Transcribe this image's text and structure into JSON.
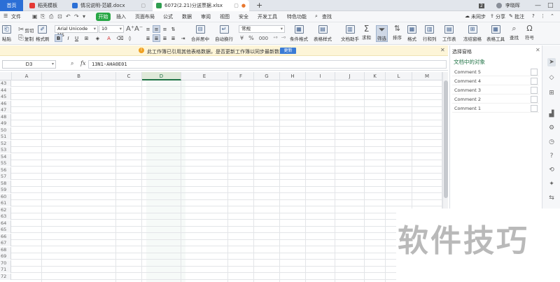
{
  "tabs": {
    "home": "首页",
    "t1": "稻壳模板",
    "t2": "情况说明-范颖.docx",
    "t3": "6072(2.21)分送票据.xlsx",
    "new_tab": "+",
    "badge": "2",
    "user": "李晓晖",
    "help": "?",
    "min": "—",
    "restore": "□",
    "close": "×"
  },
  "menu": {
    "file": "文件",
    "start": "开始",
    "insert": "插入",
    "page_layout": "页面布局",
    "formula": "公式",
    "data": "数据",
    "review": "审阅",
    "view": "视图",
    "security": "安全",
    "dev": "开发工具",
    "feature": "特色功能",
    "search": "查找",
    "sync": "未同步",
    "share": "分享",
    "comment": "批注"
  },
  "ribbon": {
    "paste": "粘贴",
    "cut": "剪切",
    "copy": "复制",
    "format_painter": "格式刷",
    "font": "Arial Unicode MS",
    "size": "10",
    "bold": "B",
    "italic": "I",
    "underline": "U",
    "merge": "合并居中",
    "wrap": "自动换行",
    "number_format": "常规",
    "percent": "%",
    "cond_format": "条件格式",
    "table_style": "表格样式",
    "doc_helper": "文档助手",
    "sum": "求和",
    "filter": "筛选",
    "sort": "排序",
    "format": "格式",
    "row_col": "行和列",
    "worksheet": "工作表",
    "freeze": "冻结窗格",
    "table_tools": "表格工具",
    "find": "查找",
    "symbol": "符号"
  },
  "notification": {
    "message": "此工作簿已引用其他表格数据，是否更新工作簿以同步最新数据？",
    "update": "更新"
  },
  "formula_bar": {
    "cell_ref": "D3",
    "fx": "fx",
    "content": "13N1-AHA0E01"
  },
  "grid": {
    "columns": [
      "A",
      "B",
      "C",
      "D",
      "E",
      "F",
      "G",
      "H",
      "I",
      "J",
      "K",
      "L",
      "M"
    ],
    "selected_column": "D",
    "rows": [
      "43",
      "44",
      "45",
      "46",
      "47",
      "48",
      "49",
      "50",
      "51",
      "52",
      "53",
      "54",
      "55",
      "56",
      "57",
      "58",
      "59",
      "60",
      "61",
      "62",
      "63",
      "64",
      "65",
      "66",
      "67",
      "68",
      "69",
      "70",
      "71",
      "72"
    ]
  },
  "pane": {
    "title": "选择窗格",
    "subtitle": "文档中的对象",
    "items": [
      "Comment 5",
      "Comment 4",
      "Comment 3",
      "Comment 2",
      "Comment 1"
    ]
  },
  "watermark": "软件技巧",
  "colors": {
    "accent": "#217346",
    "tab_active": "#2b6fd6",
    "start": "#28a745"
  }
}
